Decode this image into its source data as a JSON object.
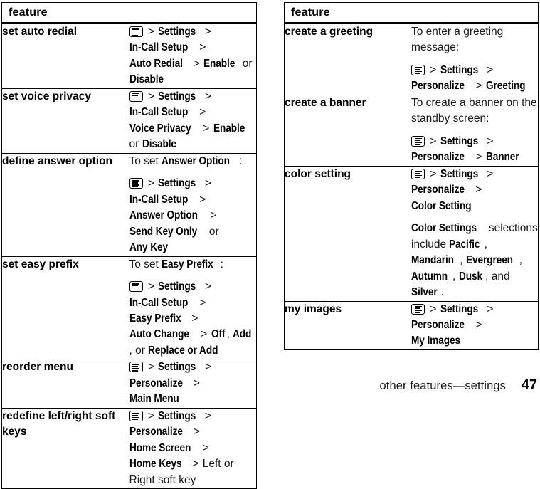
{
  "footer": {
    "title": "other features—settings",
    "page_number": "47"
  },
  "icons": {
    "menu_key": "menu-key-icon"
  },
  "tables": [
    {
      "id": "left",
      "header": "feature",
      "rows": [
        {
          "feature": "set auto redial",
          "paragraphs": [
            {
              "runs": [
                {
                  "type": "icon",
                  "text": ""
                },
                {
                  "type": "sep",
                  "text": ">"
                },
                {
                  "type": "menu",
                  "text": "Settings"
                },
                {
                  "type": "sep",
                  "text": ">"
                },
                {
                  "type": "menu",
                  "text": "In-Call Setup"
                },
                {
                  "type": "sep",
                  "text": ">"
                },
                {
                  "type": "menu",
                  "text": "Auto Redial"
                },
                {
                  "type": "sep",
                  "text": ">"
                },
                {
                  "type": "menu",
                  "text": "Enable"
                },
                {
                  "type": "plain",
                  "text": "or"
                },
                {
                  "type": "menu",
                  "text": "Disable"
                }
              ]
            }
          ]
        },
        {
          "feature": "set voice privacy",
          "paragraphs": [
            {
              "runs": [
                {
                  "type": "icon",
                  "text": ""
                },
                {
                  "type": "sep",
                  "text": ">"
                },
                {
                  "type": "menu",
                  "text": "Settings"
                },
                {
                  "type": "sep",
                  "text": ">"
                },
                {
                  "type": "menu",
                  "text": "In-Call Setup"
                },
                {
                  "type": "sep",
                  "text": ">"
                },
                {
                  "type": "menu",
                  "text": "Voice Privacy"
                },
                {
                  "type": "sep",
                  "text": ">"
                },
                {
                  "type": "menu",
                  "text": "Enable"
                },
                {
                  "type": "plain",
                  "text": "or"
                },
                {
                  "type": "menu",
                  "text": "Disable"
                }
              ]
            }
          ]
        },
        {
          "feature": "define answer option",
          "paragraphs": [
            {
              "runs": [
                {
                  "type": "plain",
                  "text": "To set"
                },
                {
                  "type": "menu",
                  "text": "Answer Option"
                },
                {
                  "type": "plain",
                  "text": ":"
                }
              ]
            },
            {
              "runs": [
                {
                  "type": "icon",
                  "text": ""
                },
                {
                  "type": "sep",
                  "text": ">"
                },
                {
                  "type": "menu",
                  "text": "Settings"
                },
                {
                  "type": "sep",
                  "text": ">"
                },
                {
                  "type": "menu",
                  "text": "In-Call Setup"
                },
                {
                  "type": "sep",
                  "text": ">"
                },
                {
                  "type": "menu",
                  "text": "Answer Option"
                },
                {
                  "type": "sep",
                  "text": ">"
                },
                {
                  "type": "menu",
                  "text": "Send Key Only"
                },
                {
                  "type": "plain",
                  "text": "or"
                },
                {
                  "type": "menu",
                  "text": "Any Key"
                }
              ]
            }
          ]
        },
        {
          "feature": "set easy prefix",
          "paragraphs": [
            {
              "runs": [
                {
                  "type": "plain",
                  "text": "To set"
                },
                {
                  "type": "menu",
                  "text": "Easy Prefix"
                },
                {
                  "type": "plain",
                  "text": ":"
                }
              ]
            },
            {
              "runs": [
                {
                  "type": "icon",
                  "text": ""
                },
                {
                  "type": "sep",
                  "text": ">"
                },
                {
                  "type": "menu",
                  "text": "Settings"
                },
                {
                  "type": "sep",
                  "text": ">"
                },
                {
                  "type": "menu",
                  "text": "In-Call Setup"
                },
                {
                  "type": "sep",
                  "text": ">"
                },
                {
                  "type": "menu",
                  "text": "Easy Prefix"
                },
                {
                  "type": "sep",
                  "text": ">"
                },
                {
                  "type": "menu",
                  "text": "Auto Change"
                },
                {
                  "type": "sep",
                  "text": ">"
                },
                {
                  "type": "menu",
                  "text": "Off"
                },
                {
                  "type": "plain",
                  "text": ","
                },
                {
                  "type": "menu",
                  "text": "Add"
                },
                {
                  "type": "plain",
                  "text": ","
                },
                {
                  "type": "plain",
                  "text": "or"
                },
                {
                  "type": "menu",
                  "text": "Replace or Add"
                }
              ]
            }
          ]
        },
        {
          "feature": "reorder menu",
          "paragraphs": [
            {
              "runs": [
                {
                  "type": "icon",
                  "text": ""
                },
                {
                  "type": "sep",
                  "text": ">"
                },
                {
                  "type": "menu",
                  "text": "Settings"
                },
                {
                  "type": "sep",
                  "text": ">"
                },
                {
                  "type": "menu",
                  "text": "Personalize"
                },
                {
                  "type": "sep",
                  "text": ">"
                },
                {
                  "type": "menu",
                  "text": "Main Menu"
                }
              ]
            }
          ]
        },
        {
          "feature": "redefine left/right soft keys",
          "paragraphs": [
            {
              "runs": [
                {
                  "type": "icon",
                  "text": ""
                },
                {
                  "type": "sep",
                  "text": ">"
                },
                {
                  "type": "menu",
                  "text": "Settings"
                },
                {
                  "type": "sep",
                  "text": ">"
                },
                {
                  "type": "menu",
                  "text": "Personalize"
                },
                {
                  "type": "sep",
                  "text": ">"
                },
                {
                  "type": "menu",
                  "text": "Home Screen"
                },
                {
                  "type": "sep",
                  "text": ">"
                },
                {
                  "type": "menu",
                  "text": "Home Keys"
                },
                {
                  "type": "sep",
                  "text": ">"
                },
                {
                  "type": "plain",
                  "text": "Left or Right soft key"
                }
              ]
            }
          ]
        }
      ]
    },
    {
      "id": "right",
      "header": "feature",
      "rows": [
        {
          "feature": "create a greeting",
          "paragraphs": [
            {
              "runs": [
                {
                  "type": "plain",
                  "text": "To enter a greeting message:"
                }
              ]
            },
            {
              "runs": [
                {
                  "type": "icon",
                  "text": ""
                },
                {
                  "type": "sep",
                  "text": ">"
                },
                {
                  "type": "menu",
                  "text": "Settings"
                },
                {
                  "type": "sep",
                  "text": ">"
                },
                {
                  "type": "menu",
                  "text": "Personalize"
                },
                {
                  "type": "sep",
                  "text": ">"
                },
                {
                  "type": "menu",
                  "text": "Greeting"
                }
              ]
            }
          ]
        },
        {
          "feature": "create a banner",
          "paragraphs": [
            {
              "runs": [
                {
                  "type": "plain",
                  "text": "To create a banner on the standby screen:"
                }
              ]
            },
            {
              "runs": [
                {
                  "type": "icon",
                  "text": ""
                },
                {
                  "type": "sep",
                  "text": ">"
                },
                {
                  "type": "menu",
                  "text": "Settings"
                },
                {
                  "type": "sep",
                  "text": ">"
                },
                {
                  "type": "menu",
                  "text": "Personalize"
                },
                {
                  "type": "sep",
                  "text": ">"
                },
                {
                  "type": "menu",
                  "text": "Banner"
                }
              ]
            }
          ]
        },
        {
          "feature": "color setting",
          "paragraphs": [
            {
              "runs": [
                {
                  "type": "icon",
                  "text": ""
                },
                {
                  "type": "sep",
                  "text": ">"
                },
                {
                  "type": "menu",
                  "text": "Settings"
                },
                {
                  "type": "sep",
                  "text": ">"
                },
                {
                  "type": "menu",
                  "text": "Personalize"
                },
                {
                  "type": "sep",
                  "text": ">"
                },
                {
                  "type": "menu",
                  "text": "Color Setting"
                }
              ]
            },
            {
              "runs": [
                {
                  "type": "menu",
                  "text": "Color Settings"
                },
                {
                  "type": "plain",
                  "text": "selections include"
                },
                {
                  "type": "menu",
                  "text": "Pacific"
                },
                {
                  "type": "plain",
                  "text": ","
                },
                {
                  "type": "menu",
                  "text": "Mandarin"
                },
                {
                  "type": "plain",
                  "text": ","
                },
                {
                  "type": "menu",
                  "text": "Evergreen"
                },
                {
                  "type": "plain",
                  "text": ","
                },
                {
                  "type": "menu",
                  "text": "Autumn"
                },
                {
                  "type": "plain",
                  "text": ","
                },
                {
                  "type": "menu",
                  "text": "Dusk"
                },
                {
                  "type": "plain",
                  "text": ","
                },
                {
                  "type": "plain",
                  "text": "and"
                },
                {
                  "type": "menu",
                  "text": "Silver"
                },
                {
                  "type": "plain",
                  "text": "."
                }
              ]
            }
          ]
        },
        {
          "feature": "my images",
          "paragraphs": [
            {
              "runs": [
                {
                  "type": "icon",
                  "text": ""
                },
                {
                  "type": "sep",
                  "text": ">"
                },
                {
                  "type": "menu",
                  "text": "Settings"
                },
                {
                  "type": "sep",
                  "text": ">"
                },
                {
                  "type": "menu",
                  "text": "Personalize"
                },
                {
                  "type": "sep",
                  "text": ">"
                },
                {
                  "type": "menu",
                  "text": "My Images"
                }
              ]
            }
          ]
        }
      ]
    }
  ]
}
